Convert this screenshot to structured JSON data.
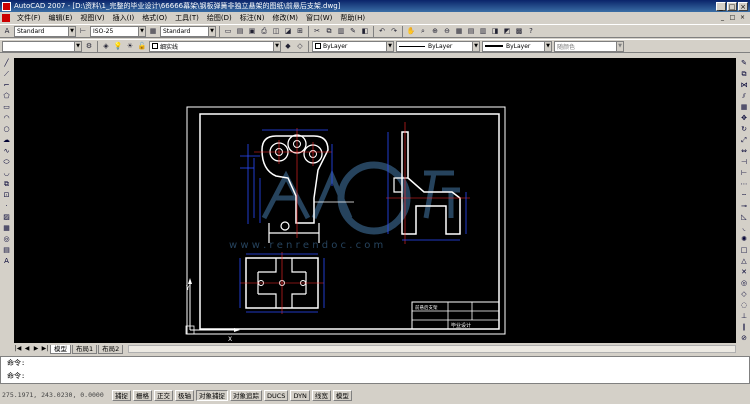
{
  "window": {
    "title": "AutoCAD 2007 - [D:\\资料\\1_完整的毕业设计\\66666幕架\\钢板弹簧非独立悬架的图纸\\前悬后支架.dwg]",
    "buttons": [
      "_",
      "□",
      "×"
    ]
  },
  "menu": {
    "items": [
      "文件(F)",
      "编辑(E)",
      "视图(V)",
      "插入(I)",
      "格式(O)",
      "工具(T)",
      "绘图(D)",
      "标注(N)",
      "修改(M)",
      "窗口(W)",
      "帮助(H)"
    ],
    "mdi_buttons": [
      "_",
      "□",
      "×"
    ]
  },
  "styles_toolbar": {
    "text_style": "Standard",
    "dim_style": "ISO-25",
    "table_style": "Standard"
  },
  "layers_toolbar": {
    "layer_name": "细实线",
    "color": "ByLayer",
    "linetype": "ByLayer",
    "lineweight": "ByLayer",
    "plot_style": "随颜色"
  },
  "tabs": {
    "items": [
      "模型",
      "布局1",
      "布局2"
    ],
    "active_index": 0
  },
  "command": {
    "line1": "命令:",
    "line2": "命令:"
  },
  "status": {
    "coordinates": "275.1971, 243.0230, 0.0000",
    "toggles": [
      "捕捉",
      "栅格",
      "正交",
      "极轴",
      "对象捕捉",
      "对象追踪",
      "DUCS",
      "DYN",
      "线宽",
      "模型"
    ],
    "on": [
      false,
      false,
      false,
      false,
      true,
      false,
      false,
      false,
      false,
      false
    ]
  },
  "drawing": {
    "watermark_site": "w w w . r e n r e n d o c . c o m",
    "title_block": {
      "row1": "前悬后支架",
      "row2": "毕业设计"
    }
  },
  "colors": {
    "canvas": "#000000",
    "outline": "#ffffff",
    "dimension": "#2a4bff",
    "centerline": "#ff2a2a",
    "watermark": "#2d4f6e"
  }
}
